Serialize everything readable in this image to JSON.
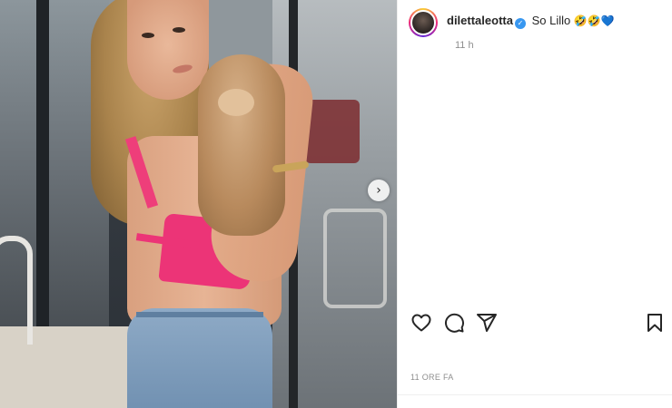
{
  "post": {
    "username": "dilettaleotta",
    "caption": "So Lillo",
    "caption_emojis": "🤣🤣💙",
    "verified_mark": "✓",
    "time_short": "11 h",
    "time_long": "11 ORE FA"
  },
  "media": {
    "next_glyph": "›"
  },
  "icons": {
    "like": "heart-icon",
    "comment": "comment-icon",
    "share": "share-icon",
    "save": "bookmark-icon",
    "next": "chevron-right-icon",
    "verified": "verified-badge-icon"
  },
  "colors": {
    "verified_blue": "#3897f0",
    "text": "#262626",
    "muted": "#8e8e8e",
    "top_pink": "#ec3477"
  }
}
